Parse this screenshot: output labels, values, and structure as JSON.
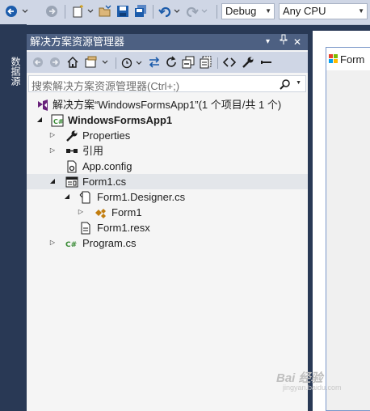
{
  "toolbar": {
    "config_value": "Debug",
    "platform_value": "Any CPU"
  },
  "side_tab": {
    "label": "数据源"
  },
  "panel": {
    "title": "解决方案资源管理器",
    "pin_glyph": "▾",
    "autohide_glyph": "📌",
    "close_glyph": "✕"
  },
  "search": {
    "placeholder": "搜索解决方案资源管理器(Ctrl+;)"
  },
  "tree": {
    "items": [
      {
        "label": "解决方案“WindowsFormsApp1”(1 个项目/共 1 个)",
        "icon": "solution-icon"
      },
      {
        "label": "WindowsFormsApp1",
        "icon": "csharp-project-icon"
      },
      {
        "label": "Properties",
        "icon": "wrench-icon"
      },
      {
        "label": "引用",
        "icon": "references-icon"
      },
      {
        "label": "App.config",
        "icon": "config-file-icon"
      },
      {
        "label": "Form1.cs",
        "icon": "form-icon"
      },
      {
        "label": "Form1.Designer.cs",
        "icon": "cs-file-icon"
      },
      {
        "label": "Form1",
        "icon": "class-icon"
      },
      {
        "label": "Form1.resx",
        "icon": "resx-file-icon"
      },
      {
        "label": "Program.cs",
        "icon": "csharp-file-icon"
      }
    ]
  },
  "document": {
    "form_title": "Form"
  },
  "watermark": {
    "text": "Bai 经验",
    "sub": "jingyan.baidu.com"
  },
  "colors": {
    "title_bar": "#4d6082",
    "toolbar_bg": "#cfd6e5",
    "selected_row": "#e3e6ea",
    "ide_frame": "#293955"
  }
}
